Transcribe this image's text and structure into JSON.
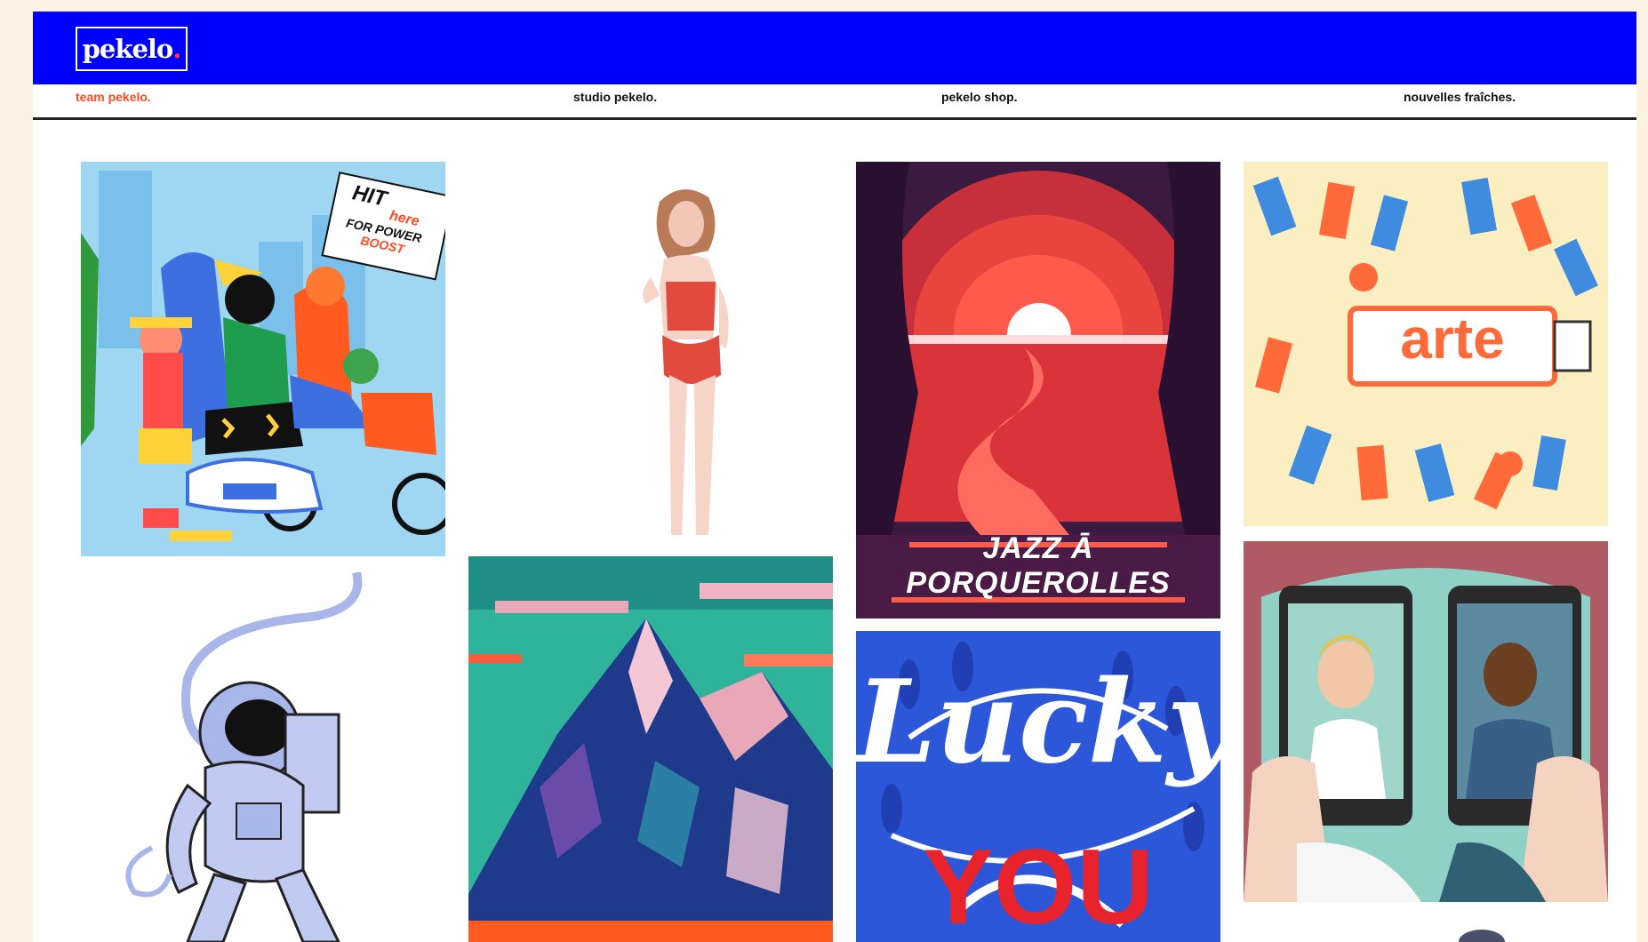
{
  "header": {
    "logo_text": "pekelo",
    "logo_dot": "."
  },
  "nav": [
    {
      "label": "team pekelo.",
      "active": true
    },
    {
      "label": "studio pekelo.",
      "active": false
    },
    {
      "label": "pekelo shop.",
      "active": false
    },
    {
      "label": "nouvelles fraîches.",
      "active": false
    }
  ],
  "gallery": {
    "tiles": [
      {
        "id": "runners",
        "sign_line1": "HIT",
        "sign_line2": "here",
        "sign_line3": "FOR POWER",
        "sign_line4": "BOOST"
      },
      {
        "id": "swimsuit-woman"
      },
      {
        "id": "jazz-porquerolles",
        "title_line1": "JAZZ Ā",
        "title_line2": "PORQUEROLLES"
      },
      {
        "id": "arte-beach",
        "banner": "arte"
      },
      {
        "id": "astronaut"
      },
      {
        "id": "mountain"
      },
      {
        "id": "lucky-you",
        "script_text": "Lucky",
        "big_text": "YOU"
      },
      {
        "id": "phone-couple"
      }
    ]
  },
  "colors": {
    "topbar": "#0000ff",
    "accent": "#ff4b1f",
    "background": "#fdf1e3"
  }
}
